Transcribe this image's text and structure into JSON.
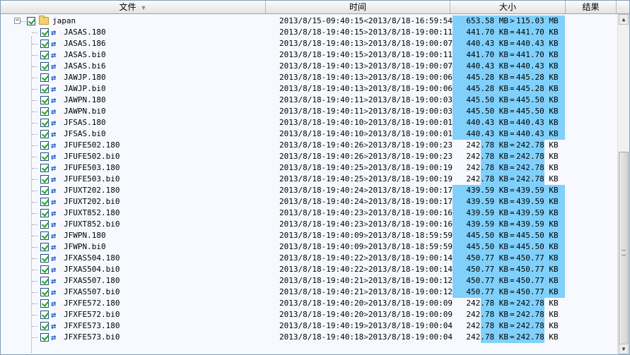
{
  "header": {
    "col_file": "文件",
    "col_time": "时间",
    "col_size": "大小",
    "col_result": "结果",
    "sort_icon": "triangle-down-icon"
  },
  "folder": {
    "name": "japan",
    "time_left": "2013/8/15-09:40:15",
    "time_arrow": "<",
    "time_right": "2013/8/18-16:59:54",
    "size_left": "653.58 MB",
    "size_arrow": ">",
    "size_right": "115.03 MB",
    "expander": "−"
  },
  "rows": [
    {
      "name": "JASAS.180",
      "tl": "2013/8/18-19:40:15",
      "tr": "2013/8/18-19:00:11",
      "sl": "441.70 KB",
      "sr": "441.70 KB",
      "bar": "long"
    },
    {
      "name": "JASAS.186",
      "tl": "2013/8/18-19:40:13",
      "tr": "2013/8/18-19:00:07",
      "sl": "440.43 KB",
      "sr": "440.43 KB",
      "bar": "long"
    },
    {
      "name": "JASAS.bi0",
      "tl": "2013/8/18-19:40:15",
      "tr": "2013/8/18-19:00:11",
      "sl": "441.70 KB",
      "sr": "441.70 KB",
      "bar": "long"
    },
    {
      "name": "JASAS.bi6",
      "tl": "2013/8/18-19:40:13",
      "tr": "2013/8/18-19:00:07",
      "sl": "440.43 KB",
      "sr": "440.43 KB",
      "bar": "long"
    },
    {
      "name": "JAWJP.180",
      "tl": "2013/8/18-19:40:13",
      "tr": "2013/8/18-19:00:06",
      "sl": "445.28 KB",
      "sr": "445.28 KB",
      "bar": "long"
    },
    {
      "name": "JAWJP.bi0",
      "tl": "2013/8/18-19:40:13",
      "tr": "2013/8/18-19:00:06",
      "sl": "445.28 KB",
      "sr": "445.28 KB",
      "bar": "long"
    },
    {
      "name": "JAWPN.180",
      "tl": "2013/8/18-19:40:11",
      "tr": "2013/8/18-19:00:03",
      "sl": "445.50 KB",
      "sr": "445.50 KB",
      "bar": "long"
    },
    {
      "name": "JAWPN.bi0",
      "tl": "2013/8/18-19:40:11",
      "tr": "2013/8/18-19:00:03",
      "sl": "445.50 KB",
      "sr": "445.50 KB",
      "bar": "long"
    },
    {
      "name": "JFSAS.180",
      "tl": "2013/8/18-19:40:10",
      "tr": "2013/8/18-19:00:01",
      "sl": "440.43 KB",
      "sr": "440.43 KB",
      "bar": "long"
    },
    {
      "name": "JFSAS.bi0",
      "tl": "2013/8/18-19:40:10",
      "tr": "2013/8/18-19:00:01",
      "sl": "440.43 KB",
      "sr": "440.43 KB",
      "bar": "long"
    },
    {
      "name": "JFUFE502.180",
      "tl": "2013/8/18-19:40:26",
      "tr": "2013/8/18-19:00:23",
      "sl": "242.78 KB",
      "sr": "242.78 KB",
      "bar": "short"
    },
    {
      "name": "JFUFE502.bi0",
      "tl": "2013/8/18-19:40:26",
      "tr": "2013/8/18-19:00:23",
      "sl": "242.78 KB",
      "sr": "242.78 KB",
      "bar": "short"
    },
    {
      "name": "JFUFE503.180",
      "tl": "2013/8/18-19:40:25",
      "tr": "2013/8/18-19:00:19",
      "sl": "242.78 KB",
      "sr": "242.78 KB",
      "bar": "short"
    },
    {
      "name": "JFUFE503.bi0",
      "tl": "2013/8/18-19:40:25",
      "tr": "2013/8/18-19:00:19",
      "sl": "242.78 KB",
      "sr": "242.78 KB",
      "bar": "short"
    },
    {
      "name": "JFUXT202.180",
      "tl": "2013/8/18-19:40:24",
      "tr": "2013/8/18-19:00:17",
      "sl": "439.59 KB",
      "sr": "439.59 KB",
      "bar": "long"
    },
    {
      "name": "JFUXT202.bi0",
      "tl": "2013/8/18-19:40:24",
      "tr": "2013/8/18-19:00:17",
      "sl": "439.59 KB",
      "sr": "439.59 KB",
      "bar": "long"
    },
    {
      "name": "JFUXT852.180",
      "tl": "2013/8/18-19:40:23",
      "tr": "2013/8/18-19:00:16",
      "sl": "439.59 KB",
      "sr": "439.59 KB",
      "bar": "long"
    },
    {
      "name": "JFUXT852.bi0",
      "tl": "2013/8/18-19:40:23",
      "tr": "2013/8/18-19:00:16",
      "sl": "439.59 KB",
      "sr": "439.59 KB",
      "bar": "long"
    },
    {
      "name": "JFWPN.180",
      "tl": "2013/8/18-19:40:09",
      "tr": "2013/8/18-18:59:59",
      "sl": "445.50 KB",
      "sr": "445.50 KB",
      "bar": "long"
    },
    {
      "name": "JFWPN.bi0",
      "tl": "2013/8/18-19:40:09",
      "tr": "2013/8/18-18:59:59",
      "sl": "445.50 KB",
      "sr": "445.50 KB",
      "bar": "long"
    },
    {
      "name": "JFXAS504.180",
      "tl": "2013/8/18-19:40:22",
      "tr": "2013/8/18-19:00:14",
      "sl": "450.77 KB",
      "sr": "450.77 KB",
      "bar": "long"
    },
    {
      "name": "JFXAS504.bi0",
      "tl": "2013/8/18-19:40:22",
      "tr": "2013/8/18-19:00:14",
      "sl": "450.77 KB",
      "sr": "450.77 KB",
      "bar": "long"
    },
    {
      "name": "JFXAS507.180",
      "tl": "2013/8/18-19:40:21",
      "tr": "2013/8/18-19:00:12",
      "sl": "450.77 KB",
      "sr": "450.77 KB",
      "bar": "long"
    },
    {
      "name": "JFXAS507.bi0",
      "tl": "2013/8/18-19:40:21",
      "tr": "2013/8/18-19:00:12",
      "sl": "450.77 KB",
      "sr": "450.77 KB",
      "bar": "long"
    },
    {
      "name": "JFXFE572.180",
      "tl": "2013/8/18-19:40:20",
      "tr": "2013/8/18-19:00:09",
      "sl": "242.78 KB",
      "sr": "242.78 KB",
      "bar": "short"
    },
    {
      "name": "JFXFE572.bi0",
      "tl": "2013/8/18-19:40:20",
      "tr": "2013/8/18-19:00:09",
      "sl": "242.78 KB",
      "sr": "242.78 KB",
      "bar": "short"
    },
    {
      "name": "JFXFE573.180",
      "tl": "2013/8/18-19:40:19",
      "tr": "2013/8/18-19:00:04",
      "sl": "242.78 KB",
      "sr": "242.78 KB",
      "bar": "short"
    },
    {
      "name": "JFXFE573.bi0",
      "tl": "2013/8/18-19:40:18",
      "tr": "2013/8/18-19:00:04",
      "sl": "242.78 KB",
      "sr": "242.78 KB",
      "bar": "short"
    }
  ],
  "row_time_arrow": ">",
  "row_size_eq": "=",
  "colors": {
    "size_bar": "#80d0fb",
    "check": "#21a121",
    "folder": "#f3d26c"
  }
}
